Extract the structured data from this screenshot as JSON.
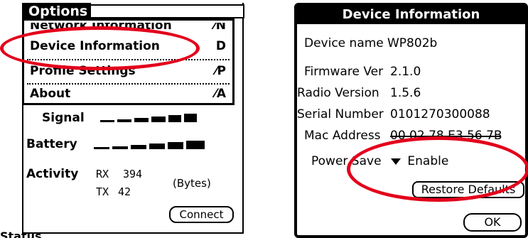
{
  "left": {
    "menu_title": "Options",
    "menu_items": [
      {
        "label": "Network Information",
        "shortcut": "⁄N"
      },
      {
        "label": "Device Information",
        "shortcut": "D"
      },
      {
        "label": "Profile Settings",
        "shortcut": "⁄P"
      },
      {
        "label": "About",
        "shortcut": "⁄A"
      }
    ],
    "signal_label": "Signal",
    "signal_level": 0.6,
    "battery_label": "Battery",
    "battery_level": 0.5,
    "activity_label": "Activity",
    "rx_label": "RX",
    "rx_value": "394",
    "tx_label": "TX",
    "tx_value": "42",
    "bytes_label": "(Bytes)",
    "connect_label": "Connect",
    "footer_text": "Status"
  },
  "right": {
    "title": "Device Information",
    "rows": [
      {
        "label": "Device name",
        "value": "WP802b"
      },
      {
        "label": "Firmware Ver",
        "value": "2.1.0"
      },
      {
        "label": "Radio Version",
        "value": "1.5.6"
      },
      {
        "label": "Serial Number",
        "value": "0101270300088"
      },
      {
        "label": "Mac Address",
        "value": "00 02 78 E3 56 7B"
      }
    ],
    "power_save_label": "Power Save",
    "power_save_value": "Enable",
    "restore_label": "Restore Defaults",
    "ok_label": "OK"
  },
  "colors": {
    "highlight": "#e3001b"
  }
}
